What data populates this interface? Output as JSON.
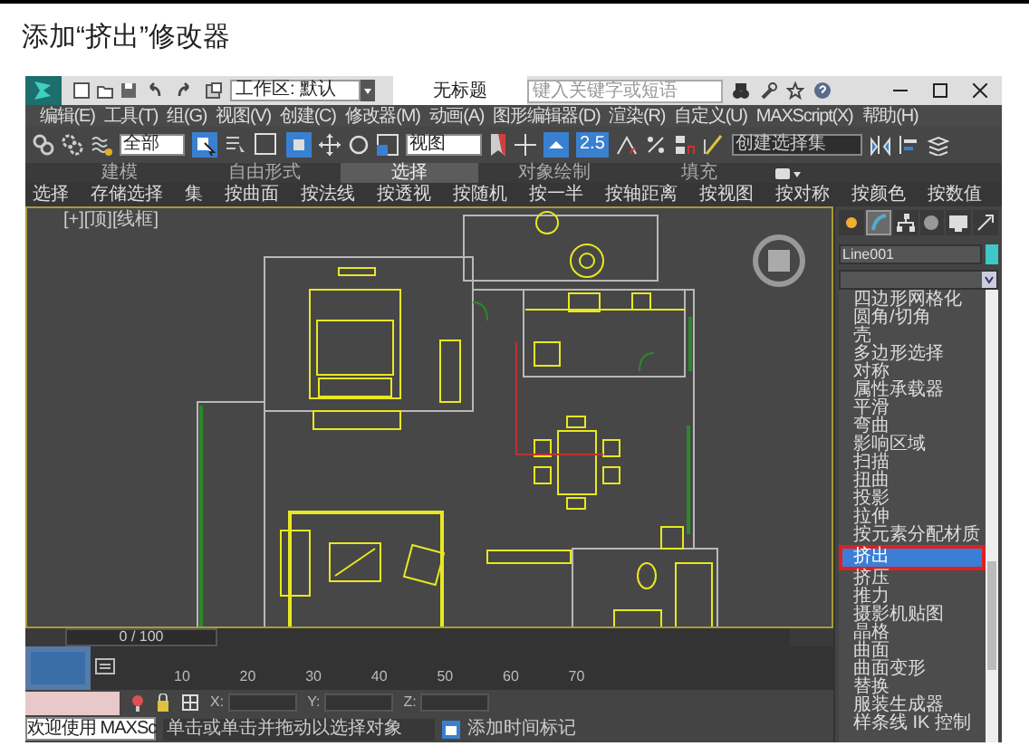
{
  "heading": "添加“挤出”修改器",
  "window": {
    "title": "无标题",
    "workspace": "工作区: 默认",
    "search": {
      "placeholder": "键入关键字或短语"
    }
  },
  "menu": [
    "编辑(E)",
    "工具(T)",
    "组(G)",
    "视图(V)",
    "创建(C)",
    "修改器(M)",
    "动画(A)",
    "图形编辑器(D)",
    "渲染(R)",
    "自定义(U)",
    "MAXScript(X)",
    "帮助(H)"
  ],
  "toolbar": {
    "selection_filter": "全部",
    "reference_coord": "视图",
    "snap_value": "2.5",
    "named_selection": "创建选择集"
  },
  "ribbon_tabs": [
    {
      "label": "建模",
      "selected": false
    },
    {
      "label": "自由形式",
      "selected": false
    },
    {
      "label": "选择",
      "selected": true
    },
    {
      "label": "对象绘制",
      "selected": false
    },
    {
      "label": "填充",
      "selected": false
    }
  ],
  "ribbon_items": [
    "选择",
    "存储选择",
    "集",
    "按曲面",
    "按法线",
    "按透视",
    "按随机",
    "按一半",
    "按轴距离",
    "按视图",
    "按对称",
    "按颜色",
    "按数值"
  ],
  "viewport": {
    "label": "[+][顶][线框]"
  },
  "command_panel": {
    "tabs": [
      {
        "selected": false
      },
      {
        "selected": true
      },
      {
        "selected": false
      },
      {
        "selected": false
      },
      {
        "selected": false
      },
      {
        "selected": false
      }
    ],
    "object_name": "Line001"
  },
  "modifiers": [
    {
      "label": "四边形网格化",
      "selected": false
    },
    {
      "label": "圆角/切角",
      "selected": false
    },
    {
      "label": "壳",
      "selected": false
    },
    {
      "label": "多边形选择",
      "selected": false
    },
    {
      "label": "对称",
      "selected": false
    },
    {
      "label": "属性承载器",
      "selected": false
    },
    {
      "label": "平滑",
      "selected": false
    },
    {
      "label": "弯曲",
      "selected": false
    },
    {
      "label": "影响区域",
      "selected": false
    },
    {
      "label": "扫描",
      "selected": false
    },
    {
      "label": "扭曲",
      "selected": false
    },
    {
      "label": "投影",
      "selected": false
    },
    {
      "label": "拉伸",
      "selected": false
    },
    {
      "label": "按元素分配材质",
      "selected": false
    },
    {
      "label": "挤出",
      "selected": true
    },
    {
      "label": "挤压",
      "selected": false
    },
    {
      "label": "推力",
      "selected": false
    },
    {
      "label": "摄影机贴图",
      "selected": false
    },
    {
      "label": "晶格",
      "selected": false
    },
    {
      "label": "曲面",
      "selected": false
    },
    {
      "label": "曲面变形",
      "selected": false
    },
    {
      "label": "替换",
      "selected": false
    },
    {
      "label": "服装生成器",
      "selected": false
    },
    {
      "label": "样条线 IK 控制",
      "selected": false
    }
  ],
  "timeline": {
    "position": "0 / 100",
    "level": 0,
    "ticks": [
      "10",
      "20",
      "30",
      "40",
      "50",
      "60",
      "70"
    ]
  },
  "status": {
    "welcome": "欢迎使用 MAXSc",
    "x_label": "X:",
    "y_label": "Y:",
    "z_label": "Z:",
    "prompt": "单击或单击并拖动以选择对象",
    "time_tag": "添加时间标记"
  }
}
